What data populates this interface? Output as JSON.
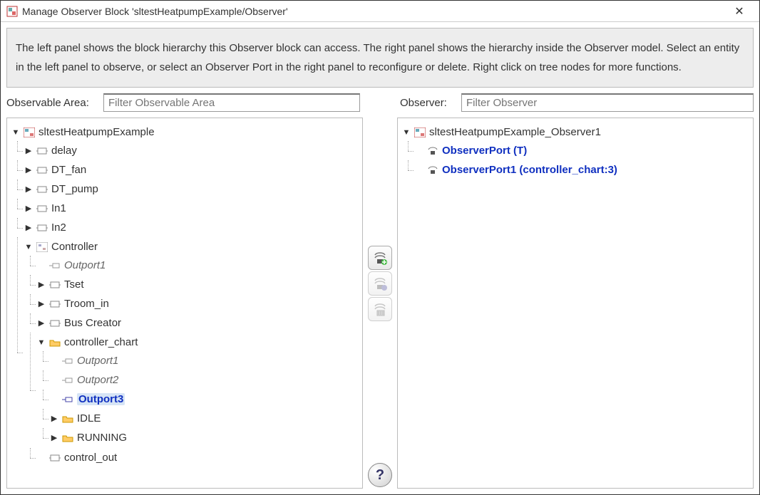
{
  "window": {
    "title": "Manage Observer Block 'sltestHeatpumpExample/Observer'"
  },
  "info": {
    "text": "The left panel shows the block hierarchy this Observer block can access. The right panel shows the hierarchy inside the Observer model. Select an entity in the left panel to observe, or select an Observer Port in the right panel to reconfigure or delete. Right click on tree nodes for more functions."
  },
  "left": {
    "label": "Observable Area:",
    "placeholder": "Filter Observable Area",
    "root": "sltestHeatpumpExample",
    "items": {
      "delay": "delay",
      "dt_fan": "DT_fan",
      "dt_pump": "DT_pump",
      "in1": "In1",
      "in2": "In2",
      "controller": "Controller",
      "outport1": "Outport1",
      "tset": "Tset",
      "troom_in": "Troom_in",
      "bus_creator": "Bus Creator",
      "controller_chart": "controller_chart",
      "cc_outport1": "Outport1",
      "cc_outport2": "Outport2",
      "cc_outport3": "Outport3",
      "idle": "IDLE",
      "running": "RUNNING",
      "control_out": "control_out"
    }
  },
  "right": {
    "label": "Observer:",
    "placeholder": "Filter Observer",
    "root": "sltestHeatpumpExample_Observer1",
    "ports": {
      "p1": "ObserverPort (T)",
      "p2": "ObserverPort1 (controller_chart:3)"
    }
  },
  "buttons": {
    "add": "add-observer-port",
    "reconfigure": "reconfigure-port",
    "delete": "delete-port",
    "help": "?"
  }
}
